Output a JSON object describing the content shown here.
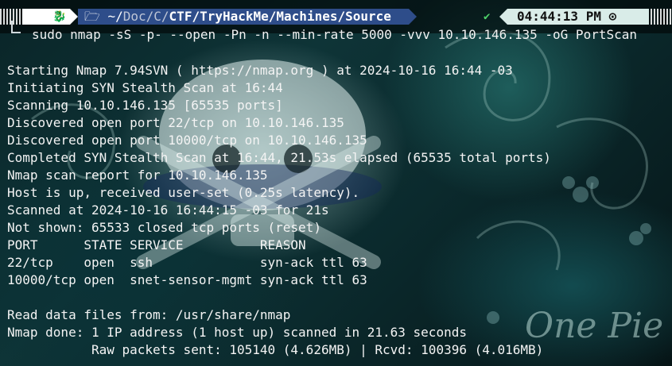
{
  "prompt": {
    "path_prefix": "~/",
    "path_dim": "Doc/C/",
    "path_bold": "CTF/TryHackMe/Machines/Source",
    "folder_icon": "folder-icon",
    "distro_icon": "kali-dragon-icon",
    "status_icon": "checkmark-icon",
    "status_symbol": "✔",
    "time": "04:44:13 PM",
    "clock_icon": "clock-icon",
    "clock_symbol": "⊙",
    "path_color": "#2e4d8a",
    "time_bg": "#d9ece8",
    "ok_color": "#4fd36a"
  },
  "command": "sudo nmap -sS -p- --open -Pn -n --min-rate 5000 -vvv 10.10.146.135 -oG PortScan",
  "output": [
    "Starting Nmap 7.94SVN ( https://nmap.org ) at 2024-10-16 16:44 -03",
    "Initiating SYN Stealth Scan at 16:44",
    "Scanning 10.10.146.135 [65535 ports]",
    "Discovered open port 22/tcp on 10.10.146.135",
    "Discovered open port 10000/tcp on 10.10.146.135",
    "Completed SYN Stealth Scan at 16:44, 21.53s elapsed (65535 total ports)",
    "Nmap scan report for 10.10.146.135",
    "Host is up, received user-set (0.25s latency).",
    "Scanned at 2024-10-16 16:44:15 -03 for 21s",
    "Not shown: 65533 closed tcp ports (reset)",
    "PORT      STATE SERVICE          REASON",
    "22/tcp    open  ssh              syn-ack ttl 63",
    "10000/tcp open  snet-sensor-mgmt syn-ack ttl 63",
    "",
    "Read data files from: /usr/share/nmap",
    "Nmap done: 1 IP address (1 host up) scanned in 21.63 seconds",
    "           Raw packets sent: 105140 (4.626MB) | Rcvd: 100396 (4.016MB)"
  ],
  "wallpaper_text": "One Pie"
}
